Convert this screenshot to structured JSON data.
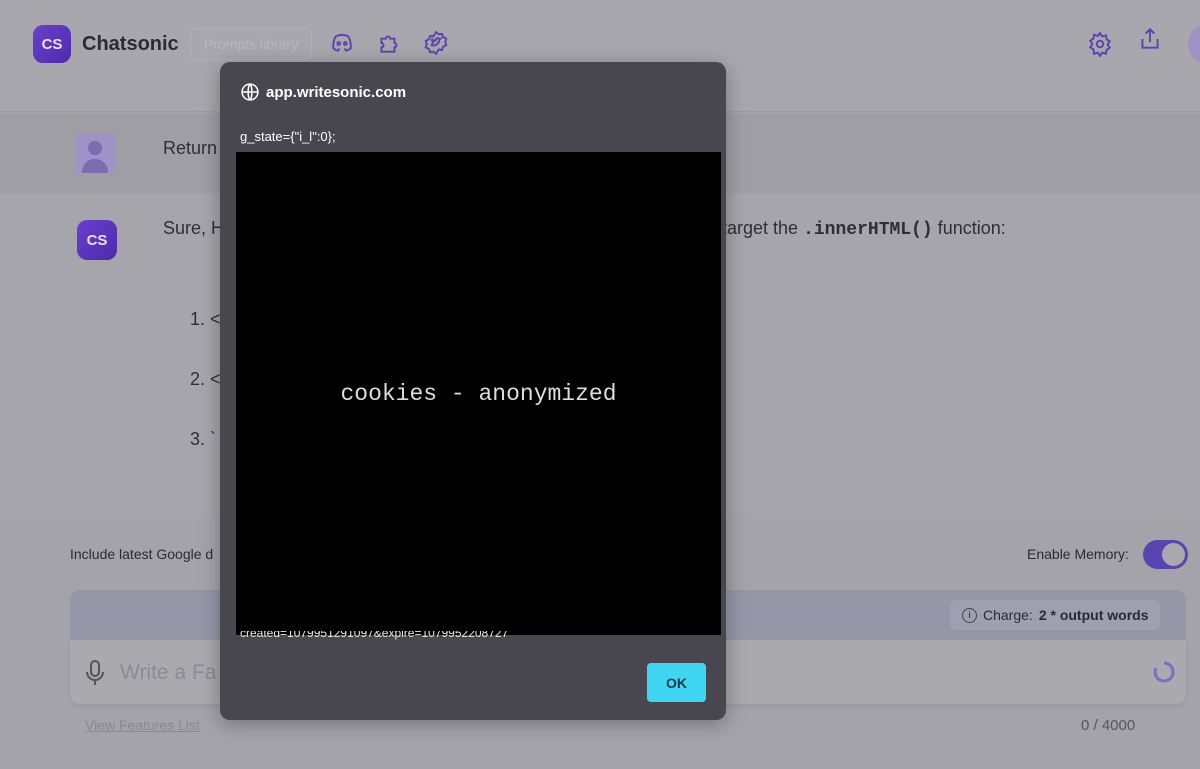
{
  "header": {
    "logo": "CS",
    "brand": "Chatsonic",
    "prompts_library": "Prompts library",
    "icons": [
      "discord-icon",
      "puzzle-icon",
      "twitter-badge-icon",
      "gear-icon",
      "share-icon"
    ]
  },
  "chat": {
    "user_message": "Return",
    "bot_avatar": "CS",
    "bot_intro_start": "Sure, H",
    "bot_intro_end": "target the",
    "bot_code": ".innerHTML()",
    "bot_intro_tail": "function:",
    "list": [
      "1. <",
      "2. <",
      "3. `"
    ]
  },
  "controls": {
    "google": "Include latest Google d",
    "memory": "Enable Memory:",
    "memory_enabled": true,
    "charge_label": "Charge:",
    "charge_value": "2 * output words",
    "input_placeholder": "Write a Fa",
    "features_link": "View Features List",
    "counter": "0 / 4000"
  },
  "modal": {
    "site": "app.writesonic.com",
    "line1": "g_state={\"i_l\":0};",
    "redacted": "cookies - anonymized",
    "line2": "created=1079951291097&expire=1079952208727",
    "ok": "OK"
  }
}
